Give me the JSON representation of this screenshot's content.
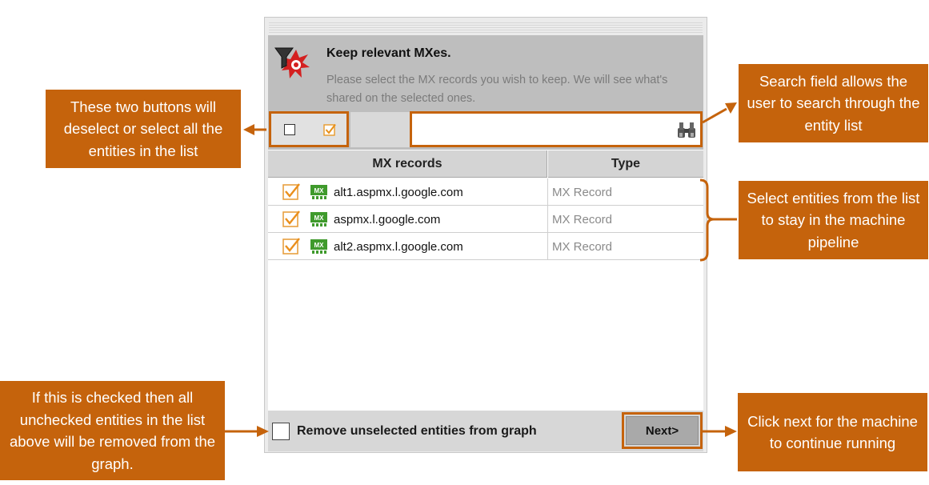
{
  "dialog": {
    "title": "Keep relevant MXes.",
    "description": "Please select the MX records you wish to keep. We will see what's shared on the selected ones."
  },
  "toolbar": {
    "deselect_all_icon": "checkbox-empty-icon",
    "select_all_icon": "checkbox-checked-icon",
    "search_placeholder": "",
    "search_icon": "binoculars-icon"
  },
  "table": {
    "columns": [
      "MX records",
      "Type"
    ],
    "rows": [
      {
        "name": "alt1.aspmx.l.google.com",
        "type": "MX Record",
        "checked": true,
        "icon": "mx-record-icon"
      },
      {
        "name": "aspmx.l.google.com",
        "type": "MX Record",
        "checked": true,
        "icon": "mx-record-icon"
      },
      {
        "name": "alt2.aspmx.l.google.com",
        "type": "MX Record",
        "checked": true,
        "icon": "mx-record-icon"
      }
    ],
    "icon_label": "MX"
  },
  "footer": {
    "remove_label": "Remove unselected entities from graph",
    "remove_checked": false,
    "next_label": "Next>"
  },
  "callouts": {
    "buttons": "These two buttons will deselect or select all the entities in the list",
    "search": "Search field allows the user to search through the entity list",
    "select": "Select entities from the list to stay in the machine pipeline",
    "remove": "If this is checked then all unchecked entities in the list above will be removed from the graph.",
    "next": "Click next for the machine to continue running"
  },
  "colors": {
    "accent": "#c5630c",
    "check": "#f0a030",
    "mx_icon": "#4a9a2a"
  }
}
